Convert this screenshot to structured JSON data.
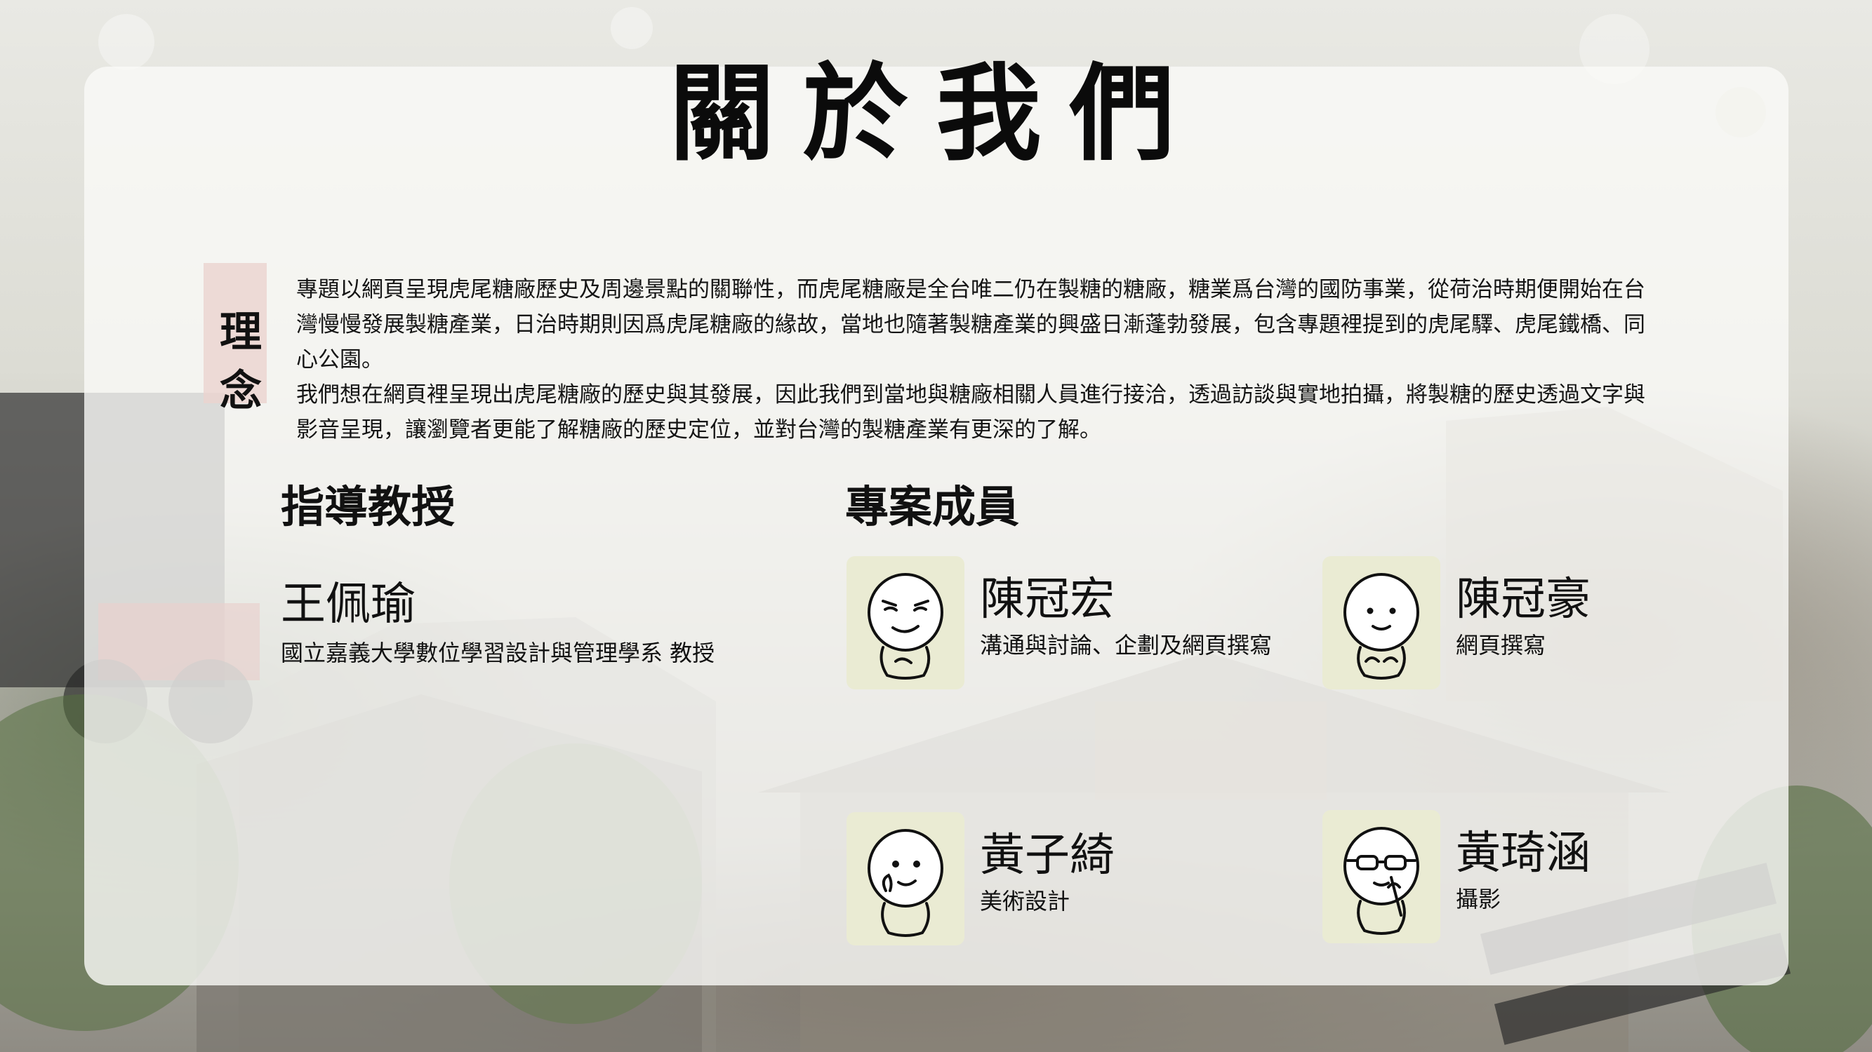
{
  "page": {
    "title": "關於我們"
  },
  "concept": {
    "label": "理念",
    "paragraphs": [
      "專題以網頁呈現虎尾糖廠歷史及周邊景點的關聯性，而虎尾糖廠是全台唯二仍在製糖的糖廠，糖業爲台灣的國防事業，從荷治時期便開始在台灣慢慢發展製糖產業，日治時期則因爲虎尾糖廠的緣故，當地也隨著製糖產業的興盛日漸蓬勃發展，包含專題裡提到的虎尾驛、虎尾鐵橋、同心公園。",
      "我們想在網頁裡呈現出虎尾糖廠的歷史與其發展，因此我們到當地與糖廠相關人員進行接洽，透過訪談與實地拍攝，將製糖的歷史透過文字與影音呈現，讓瀏覽者更能了解糖廠的歷史定位，並對台灣的製糖產業有更深的了解。"
    ]
  },
  "advisor": {
    "heading": "指導教授",
    "name": "王佩瑜",
    "title": "國立嘉義大學數位學習設計與管理學系 教授"
  },
  "team": {
    "heading": "專案成員",
    "members": [
      {
        "name": "陳冠宏",
        "role": "溝通與討論、企劃及網頁撰寫",
        "avatar": "smirk-face-icon"
      },
      {
        "name": "陳冠豪",
        "role": "網頁撰寫",
        "avatar": "smile-face-icon"
      },
      {
        "name": "黃子綺",
        "role": "美術設計",
        "avatar": "thinking-face-icon"
      },
      {
        "name": "黃琦涵",
        "role": "攝影",
        "avatar": "glasses-face-icon"
      }
    ]
  },
  "colors": {
    "card": "#fafaf7",
    "avatar_bg": "#eaebd3",
    "text": "#111111"
  }
}
